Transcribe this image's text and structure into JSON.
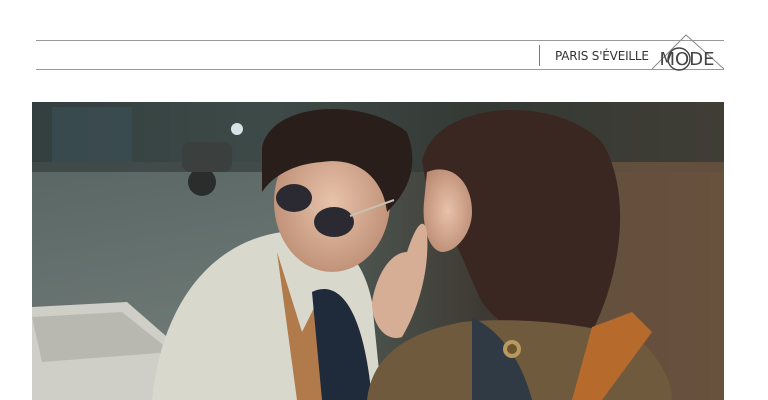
{
  "header": {
    "kicker": "PARIS S'ÉVEILLE",
    "logo_text": "MODE"
  },
  "hero_image": {
    "icon": "photo-couple-icon"
  },
  "colors": {
    "rule": "#9a9a9a",
    "text": "#333333"
  }
}
